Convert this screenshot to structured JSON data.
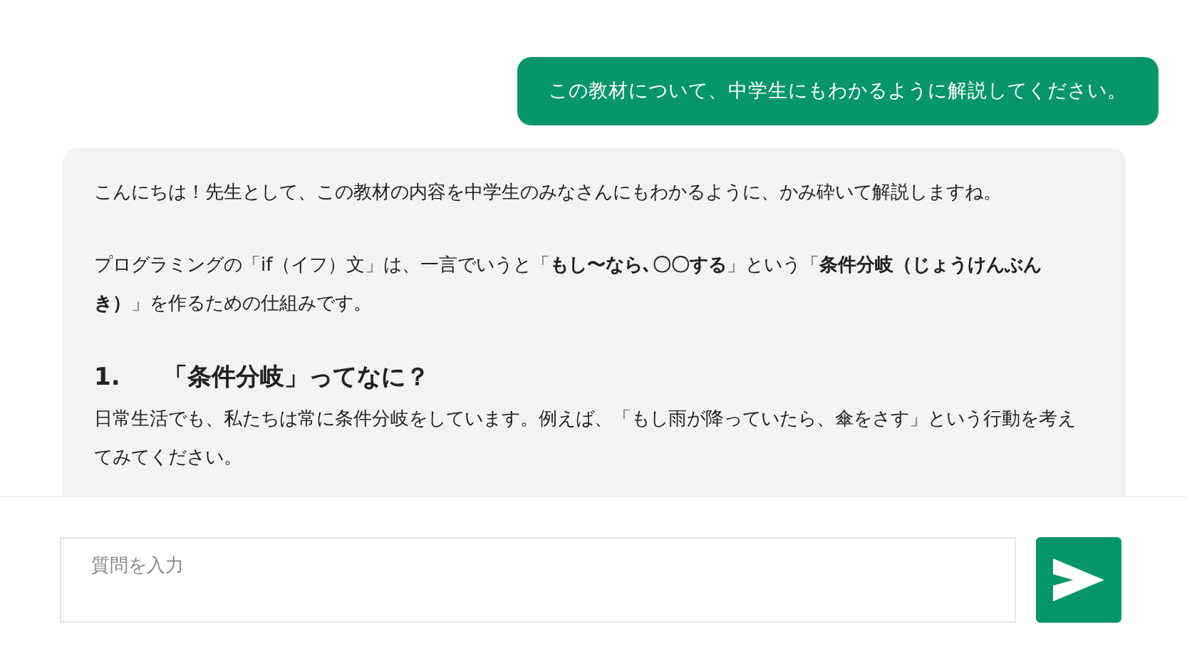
{
  "messages": [
    {
      "kind": "user",
      "text": "この教材について、中学生にもわかるように解説してください。"
    },
    {
      "kind": "assistant",
      "blocks": [
        {
          "kind": "paragraph",
          "text": "こんにちは！先生として、この教材の内容を中学生のみなさんにもわかるように、かみ砕いて解説しますね。"
        },
        {
          "kind": "paragraph",
          "text": "プログラミングの「if（イフ）文」は、一言でいうと「**もし〜なら､〇〇する**」という「**条件分岐（じょうけんぶんき）**」を作るための仕組みです。"
        },
        {
          "kind": "heading",
          "number": "1.",
          "text": "「条件分岐」ってなに？"
        },
        {
          "kind": "paragraph",
          "text": "日常生活でも、私たちは常に条件分岐をしています。例えば、「もし雨が降っていたら、傘をさす」という行動を考えてみてください。"
        }
      ]
    }
  ],
  "composer": {
    "placeholder": "質問を入力"
  }
}
